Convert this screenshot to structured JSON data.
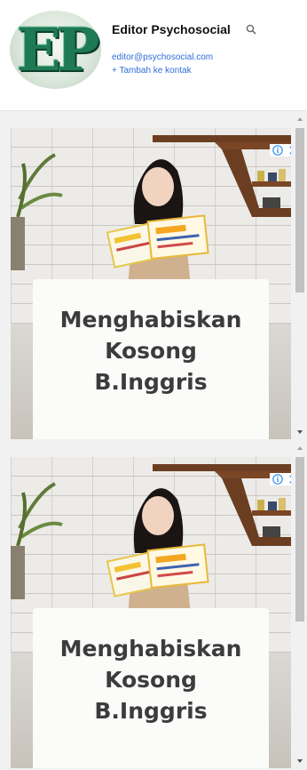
{
  "profile": {
    "avatar_text": "EP",
    "name": "Editor Psychosocial",
    "email": "editor@psychosocial.com",
    "add_contact": "+ Tambah ke kontak"
  },
  "ads": [
    {
      "headline_lines": [
        "Menghabiskan",
        "Kosong",
        "B.Inggris"
      ]
    },
    {
      "headline_lines": [
        "Menghabiskan",
        "Kosong",
        "B.Inggris"
      ]
    }
  ],
  "icons": {
    "search": "search-icon",
    "info": "info-icon",
    "close": "close-icon",
    "scroll_up": "chevron-up-icon",
    "scroll_down": "chevron-down-icon"
  },
  "colors": {
    "link": "#2f6fd6",
    "avatar_green": "#1d7a55",
    "headline": "#3c3c3c",
    "ad_info": "#2f8ff0"
  }
}
